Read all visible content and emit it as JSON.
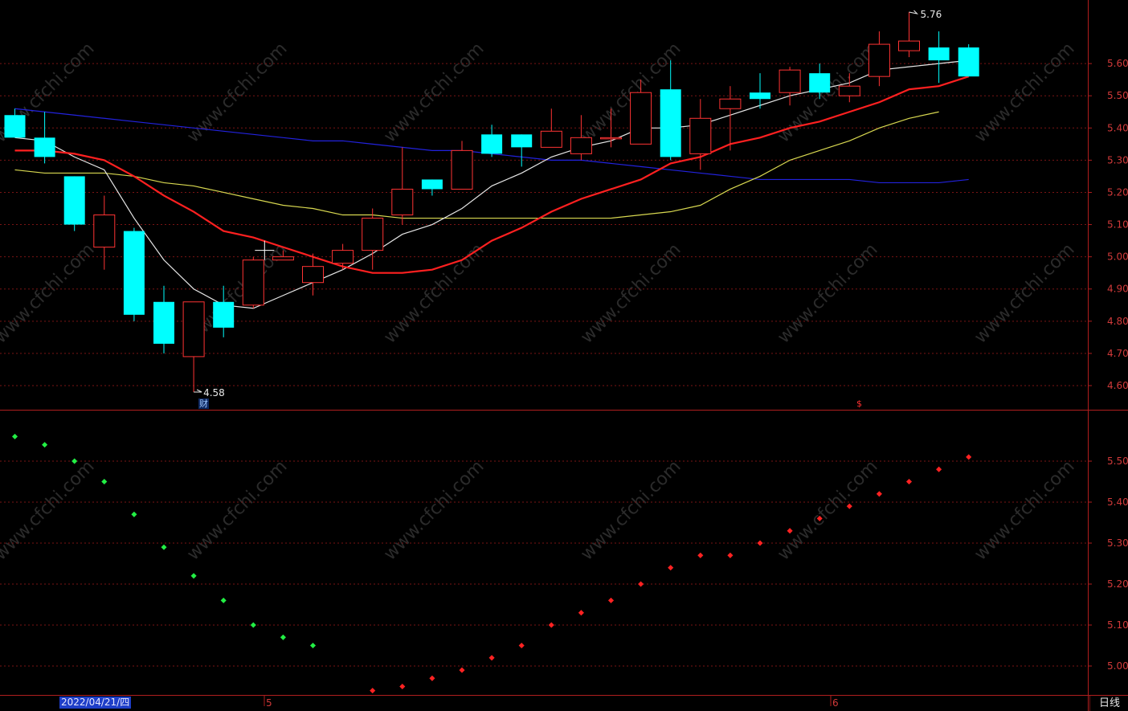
{
  "chart_data": [
    {
      "type": "candlestick",
      "panel": "main",
      "ylim": [
        4.53,
        5.76
      ],
      "y_ticks": [
        "5.60",
        "5.50",
        "5.40",
        "5.30",
        "5.20",
        "5.10",
        "5.00",
        "4.90",
        "4.80",
        "4.70",
        "4.60"
      ],
      "candles": [
        {
          "o": 5.44,
          "h": 5.46,
          "l": 5.39,
          "c": 5.37
        },
        {
          "o": 5.37,
          "h": 5.45,
          "l": 5.29,
          "c": 5.31
        },
        {
          "o": 5.25,
          "h": 5.25,
          "l": 5.08,
          "c": 5.1
        },
        {
          "o": 5.03,
          "h": 5.19,
          "l": 4.96,
          "c": 5.13
        },
        {
          "o": 5.08,
          "h": 5.09,
          "l": 4.8,
          "c": 4.82
        },
        {
          "o": 4.86,
          "h": 4.91,
          "l": 4.7,
          "c": 4.73
        },
        {
          "o": 4.69,
          "h": 4.86,
          "l": 4.58,
          "c": 4.86
        },
        {
          "o": 4.86,
          "h": 4.91,
          "l": 4.75,
          "c": 4.78
        },
        {
          "o": 4.85,
          "h": 5.0,
          "l": 4.84,
          "c": 4.99
        },
        {
          "o": 4.99,
          "h": 5.02,
          "l": 4.99,
          "c": 5.0
        },
        {
          "o": 4.92,
          "h": 5.01,
          "l": 4.88,
          "c": 4.97
        },
        {
          "o": 4.98,
          "h": 5.04,
          "l": 4.96,
          "c": 5.02
        },
        {
          "o": 5.02,
          "h": 5.15,
          "l": 4.96,
          "c": 5.12
        },
        {
          "o": 5.13,
          "h": 5.34,
          "l": 5.1,
          "c": 5.21
        },
        {
          "o": 5.24,
          "h": 5.24,
          "l": 5.19,
          "c": 5.21
        },
        {
          "o": 5.21,
          "h": 5.36,
          "l": 5.21,
          "c": 5.33
        },
        {
          "o": 5.38,
          "h": 5.41,
          "l": 5.31,
          "c": 5.32
        },
        {
          "o": 5.38,
          "h": 5.38,
          "l": 5.28,
          "c": 5.34
        },
        {
          "o": 5.34,
          "h": 5.46,
          "l": 5.34,
          "c": 5.39
        },
        {
          "o": 5.32,
          "h": 5.44,
          "l": 5.3,
          "c": 5.37
        },
        {
          "o": 5.37,
          "h": 5.46,
          "l": 5.34,
          "c": 5.37
        },
        {
          "o": 5.35,
          "h": 5.55,
          "l": 5.35,
          "c": 5.51
        },
        {
          "o": 5.52,
          "h": 5.61,
          "l": 5.3,
          "c": 5.31
        },
        {
          "o": 5.32,
          "h": 5.49,
          "l": 5.27,
          "c": 5.43
        },
        {
          "o": 5.46,
          "h": 5.53,
          "l": 5.33,
          "c": 5.49
        },
        {
          "o": 5.51,
          "h": 5.57,
          "l": 5.46,
          "c": 5.49
        },
        {
          "o": 5.51,
          "h": 5.59,
          "l": 5.47,
          "c": 5.58
        },
        {
          "o": 5.57,
          "h": 5.6,
          "l": 5.49,
          "c": 5.51
        },
        {
          "o": 5.5,
          "h": 5.57,
          "l": 5.48,
          "c": 5.53
        },
        {
          "o": 5.56,
          "h": 5.7,
          "l": 5.53,
          "c": 5.66
        },
        {
          "o": 5.64,
          "h": 5.76,
          "l": 5.62,
          "c": 5.67
        },
        {
          "o": 5.65,
          "h": 5.7,
          "l": 5.54,
          "c": 5.61
        },
        {
          "o": 5.65,
          "h": 5.66,
          "l": 5.56,
          "c": 5.56
        }
      ],
      "ma_white": [
        5.37,
        5.36,
        5.31,
        5.27,
        5.12,
        4.99,
        4.9,
        4.85,
        4.84,
        4.88,
        4.92,
        4.96,
        5.01,
        5.07,
        5.1,
        5.15,
        5.22,
        5.26,
        5.31,
        5.34,
        5.36,
        5.4,
        5.4,
        5.41,
        5.44,
        5.47,
        5.5,
        5.52,
        5.54,
        5.58,
        5.59,
        5.6,
        5.61
      ],
      "ma_red": [
        5.33,
        5.33,
        5.32,
        5.3,
        5.25,
        5.19,
        5.14,
        5.08,
        5.06,
        5.03,
        5.0,
        4.97,
        4.95,
        4.95,
        4.96,
        4.99,
        5.05,
        5.09,
        5.14,
        5.18,
        5.21,
        5.24,
        5.29,
        5.31,
        5.35,
        5.37,
        5.4,
        5.42,
        5.45,
        5.48,
        5.52,
        5.53,
        5.56
      ],
      "ma_yellow": [
        5.27,
        5.26,
        5.26,
        5.26,
        5.25,
        5.23,
        5.22,
        5.2,
        5.18,
        5.16,
        5.15,
        5.13,
        5.13,
        5.12,
        5.12,
        5.12,
        5.12,
        5.12,
        5.12,
        5.12,
        5.12,
        5.13,
        5.14,
        5.16,
        5.21,
        5.25,
        5.3,
        5.33,
        5.36,
        5.4,
        5.43,
        5.45
      ],
      "ma_blue": [
        5.46,
        5.45,
        5.44,
        5.43,
        5.42,
        5.41,
        5.4,
        5.39,
        5.38,
        5.37,
        5.36,
        5.36,
        5.35,
        5.34,
        5.33,
        5.33,
        5.32,
        5.31,
        5.3,
        5.3,
        5.29,
        5.28,
        5.27,
        5.26,
        5.25,
        5.24,
        5.24,
        5.24,
        5.24,
        5.23,
        5.23,
        5.23,
        5.24
      ],
      "annotations": {
        "high": "5.76",
        "low": "4.58"
      }
    },
    {
      "type": "scatter",
      "panel": "sar",
      "ylim": [
        4.94,
        5.61
      ],
      "y_ticks": [
        "5.50",
        "5.40",
        "5.30",
        "5.20",
        "5.10",
        "5.00"
      ],
      "values": [
        5.56,
        5.54,
        5.5,
        5.45,
        5.37,
        5.29,
        5.22,
        5.16,
        5.1,
        5.07,
        5.05,
        null,
        4.94,
        4.95,
        4.97,
        4.99,
        5.02,
        5.05,
        5.1,
        5.13,
        5.16,
        5.2,
        5.24,
        5.27,
        5.27,
        5.3,
        5.33,
        5.36,
        5.39,
        5.42,
        5.45,
        5.48,
        5.51
      ],
      "colors": {
        "rising": "#ff2222",
        "falling": "#22ee44"
      },
      "rising_from_index": 12
    }
  ],
  "x_labels": {
    "date": "2022/04/21/四",
    "month5": "5",
    "month6": "6"
  },
  "period_tab": "日线",
  "markers": {
    "cai": "财",
    "dollar": "$"
  },
  "watermark": "www.cfchi.com",
  "colors": {
    "up": "#ff3333",
    "down": "#00ffff",
    "ma_white": "#e6e6e6",
    "ma_red": "#ff2020",
    "ma_yellow": "#d8d850",
    "ma_blue": "#2222dd",
    "grid": "#7a1414"
  }
}
